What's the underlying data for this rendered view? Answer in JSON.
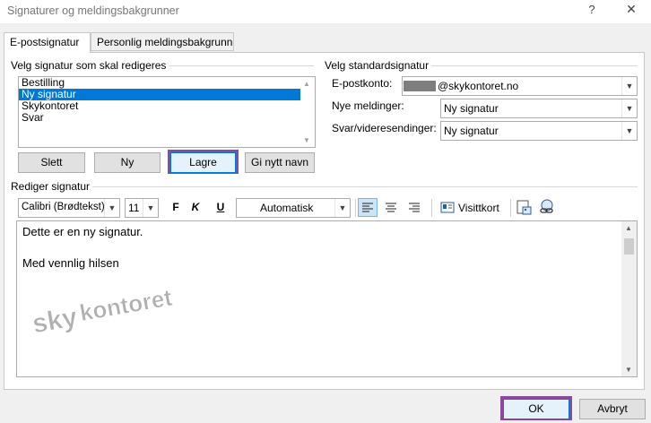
{
  "window": {
    "title": "Signaturer og meldingsbakgrunner",
    "help_glyph": "?",
    "close_glyph": "✕"
  },
  "tabs": [
    {
      "label": "E-postsignatur",
      "active": true
    },
    {
      "label": "Personlig meldingsbakgrunn",
      "active": false
    }
  ],
  "edit_signature": {
    "group_label": "Velg signatur som skal redigeres",
    "list": [
      "Bestilling",
      "Ny signatur",
      "Skykontoret",
      "Svar"
    ],
    "selected": "Ny signatur",
    "buttons": {
      "delete": "Slett",
      "new": "Ny",
      "save": "Lagre",
      "rename": "Gi nytt navn"
    }
  },
  "default_signature": {
    "group_label": "Velg standardsignatur",
    "account_label": "E-postkonto:",
    "account_value": "@skykontoret.no",
    "new_messages_label": "Nye meldinger:",
    "new_messages_value": "Ny signatur",
    "replies_label": "Svar/videresendinger:",
    "replies_value": "Ny signatur"
  },
  "editor": {
    "group_label": "Rediger signatur",
    "font": "Calibri (Brødtekst)",
    "size": "11",
    "bold": "F",
    "italic": "K",
    "underline": "U",
    "color": "Automatisk",
    "business_card": "Visittkort",
    "line1": "Dette er en ny signatur.",
    "line2": "Med vennlig hilsen",
    "watermark_text": "skykontoret"
  },
  "footer": {
    "ok": "OK",
    "cancel": "Avbryt"
  },
  "colors": {
    "selection": "#0078d7",
    "highlight_border": "#8b4a9c",
    "watermark": "#b0b0b0"
  }
}
